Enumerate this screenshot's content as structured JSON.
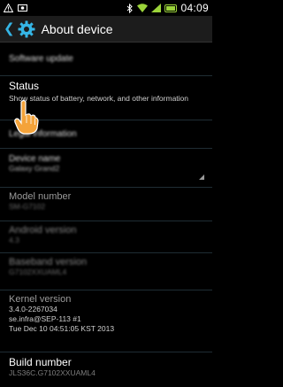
{
  "status_bar": {
    "time": "04:09",
    "battery_color": "#9bd33a"
  },
  "action_bar": {
    "back_icon": "chevron-left-icon",
    "app_icon": "settings-gear-icon",
    "title": "About device"
  },
  "items": {
    "software_update": {
      "title": "Software update"
    },
    "status": {
      "title": "Status",
      "summary": "Show status of battery, network, and other information"
    },
    "legal": {
      "title": "Legal information"
    },
    "device_name": {
      "title": "Device name",
      "value": "Galaxy Grand2"
    },
    "model_number": {
      "title": "Model number",
      "value": "SM-G7102"
    },
    "android_version": {
      "title": "Android version",
      "value": "4.3"
    },
    "baseband_version": {
      "title": "Baseband version",
      "value": "G7102XXUAML4"
    },
    "kernel_version": {
      "title": "Kernel version",
      "line1": "3.4.0-2267034",
      "line2": "se.infra@SEP-113 #1",
      "line3": "Tue Dec 10 04:51:05 KST 2013"
    },
    "build_number": {
      "title": "Build number",
      "value": "JLS36C.G7102XXUAML4"
    }
  },
  "colors": {
    "accent": "#35b5e5",
    "divider": "#1f2d34",
    "hand": "#f4a33a"
  }
}
